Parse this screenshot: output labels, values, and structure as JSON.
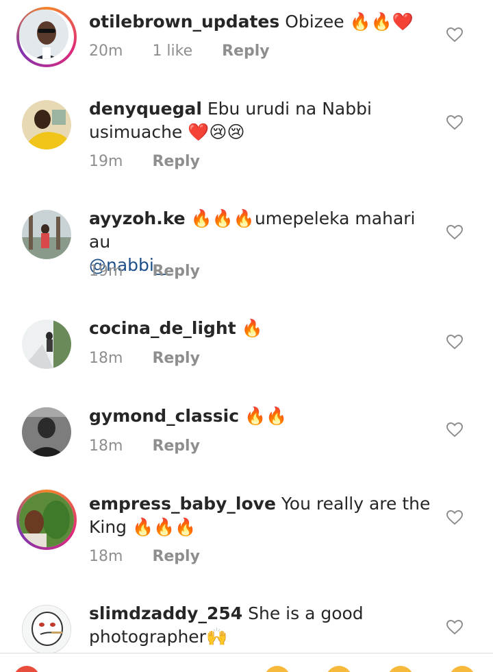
{
  "comments": [
    {
      "username": "otilebrown_updates",
      "text": "Obizee 🔥🔥❤️",
      "time": "20m",
      "likes": "1 like",
      "reply": "Reply",
      "avatar_icon": "person-sunglasses-avatar",
      "story_ring": true
    },
    {
      "username": "denyquegal",
      "text": "Ebu urudi  na Nabbi usimuache ❤️😢😢",
      "time": "19m",
      "reply": "Reply",
      "avatar_icon": "woman-yellow-avatar",
      "story_ring": false
    },
    {
      "username": "ayyzoh.ke",
      "text": "🔥🔥🔥umepeleka mahari au",
      "mention": "@nabbi__",
      "time": "19m",
      "reply": "Reply",
      "avatar_icon": "outdoor-avatar",
      "story_ring": false
    },
    {
      "username": "cocina_de_light",
      "text": "🔥",
      "time": "18m",
      "reply": "Reply",
      "avatar_icon": "street-avatar",
      "story_ring": false
    },
    {
      "username": "gymond_classic",
      "text": "🔥🔥",
      "time": "18m",
      "reply": "Reply",
      "avatar_icon": "bw-portrait-avatar",
      "story_ring": false
    },
    {
      "username": "empress_baby_love",
      "text": "You really are the King 🔥🔥🔥",
      "time": "18m",
      "reply": "Reply",
      "avatar_icon": "selfie-avatar",
      "story_ring": true
    },
    {
      "username": "slimdzaddy_254",
      "text": "She is a good photographer🙌",
      "avatar_icon": "cartoon-face-avatar",
      "story_ring": false
    }
  ],
  "colors": {
    "text": "#262626",
    "meta": "#8e8e8e",
    "mention": "#1c4f8a",
    "heart": "#8e8e8e"
  }
}
